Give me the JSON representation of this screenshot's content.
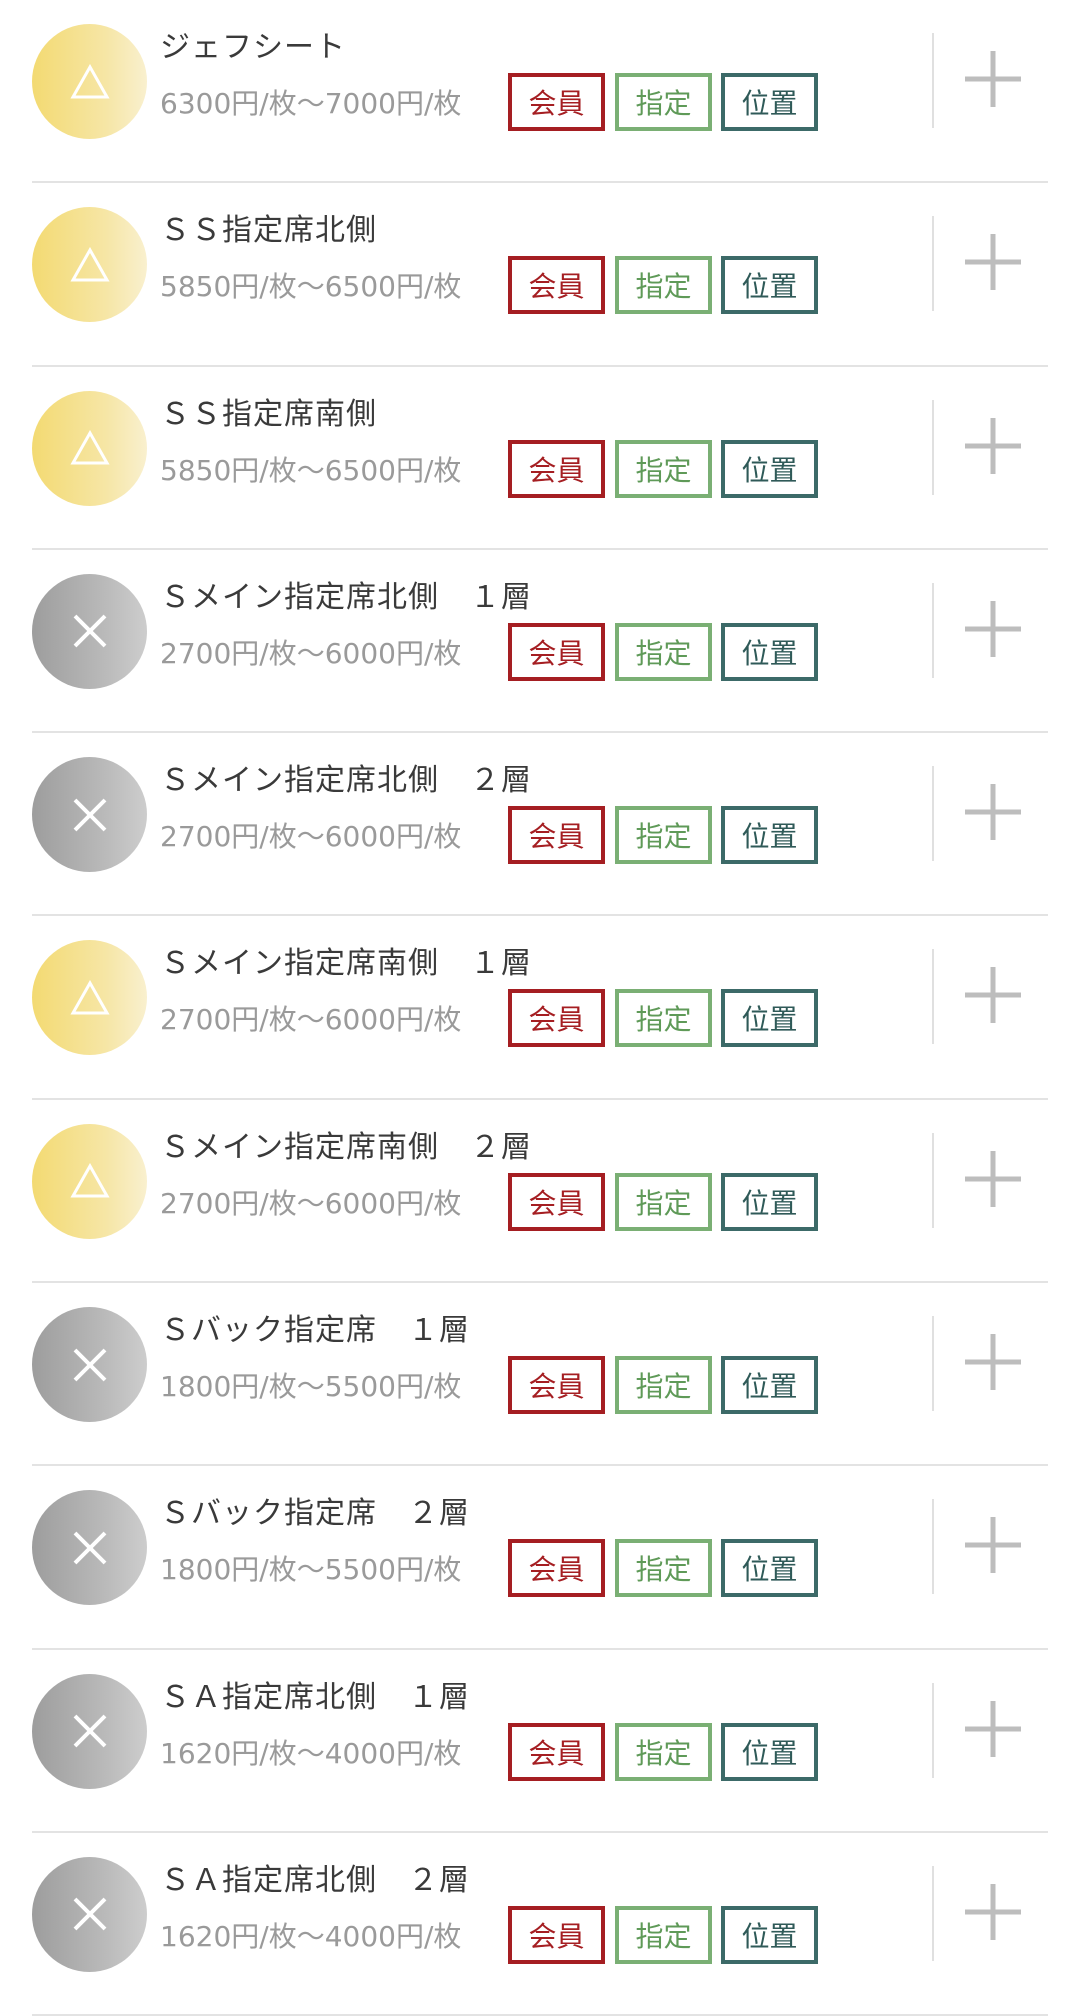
{
  "tag_labels": {
    "member": "会員",
    "reserved": "指定",
    "position": "位置"
  },
  "seats": [
    {
      "name": "ジェフシート",
      "price": "6300円/枚〜7000円/枚",
      "status": "triangle"
    },
    {
      "name": "ＳＳ指定席北側",
      "price": "5850円/枚〜6500円/枚",
      "status": "triangle"
    },
    {
      "name": "ＳＳ指定席南側",
      "price": "5850円/枚〜6500円/枚",
      "status": "triangle"
    },
    {
      "name": "Ｓメイン指定席北側　１層",
      "price": "2700円/枚〜6000円/枚",
      "status": "cross"
    },
    {
      "name": "Ｓメイン指定席北側　２層",
      "price": "2700円/枚〜6000円/枚",
      "status": "cross"
    },
    {
      "name": "Ｓメイン指定席南側　１層",
      "price": "2700円/枚〜6000円/枚",
      "status": "triangle"
    },
    {
      "name": "Ｓメイン指定席南側　２層",
      "price": "2700円/枚〜6000円/枚",
      "status": "triangle"
    },
    {
      "name": "Ｓバック指定席　１層",
      "price": "1800円/枚〜5500円/枚",
      "status": "cross"
    },
    {
      "name": "Ｓバック指定席　２層",
      "price": "1800円/枚〜5500円/枚",
      "status": "cross"
    },
    {
      "name": "ＳＡ指定席北側　１層",
      "price": "1620円/枚〜4000円/枚",
      "status": "cross"
    },
    {
      "name": "ＳＡ指定席北側　２層",
      "price": "1620円/枚〜4000円/枚",
      "status": "cross"
    }
  ],
  "icons": {
    "triangle": "availability-limited-icon",
    "cross": "sold-out-icon",
    "add": "plus-icon"
  },
  "colors": {
    "member": "#a51e22",
    "reserved": "#7aaf74",
    "position": "#3c6a68",
    "limited": "#f3da72",
    "soldout": "#a8a8a8"
  }
}
